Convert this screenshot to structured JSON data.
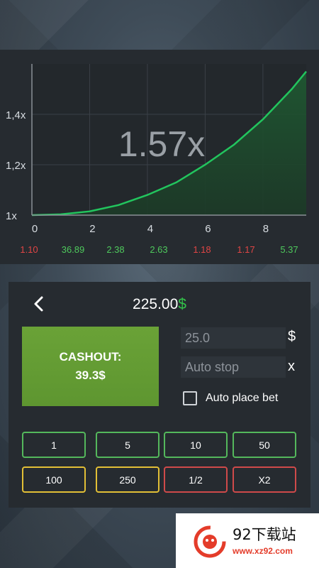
{
  "chart": {
    "multiplier": "1.57x",
    "y_ticks": [
      "1x",
      "1,2x",
      "1,4x"
    ],
    "x_ticks": [
      "0",
      "2",
      "4",
      "6",
      "8"
    ],
    "line_color": "#22c55e"
  },
  "chart_data": {
    "type": "area",
    "title": "",
    "xlabel": "",
    "ylabel": "",
    "xlim": [
      0,
      9.5
    ],
    "ylim": [
      1,
      1.6
    ],
    "x": [
      0,
      1,
      2,
      3,
      4,
      5,
      6,
      7,
      8,
      9,
      9.5
    ],
    "y": [
      1.0,
      1.003,
      1.015,
      1.04,
      1.08,
      1.13,
      1.2,
      1.28,
      1.38,
      1.5,
      1.57
    ],
    "grid": true
  },
  "history": [
    {
      "value": "1.10",
      "color": "red"
    },
    {
      "value": "36.89",
      "color": "green"
    },
    {
      "value": "2.38",
      "color": "green"
    },
    {
      "value": "2.63",
      "color": "green"
    },
    {
      "value": "1.18",
      "color": "red"
    },
    {
      "value": "1.17",
      "color": "red"
    },
    {
      "value": "5.37",
      "color": "green"
    }
  ],
  "bet_panel": {
    "balance_amount": "225.00",
    "balance_currency": "$",
    "cashout_label": "CASHOUT:",
    "cashout_amount": "39.3$",
    "bet_value": "25.0",
    "bet_suffix": "$",
    "auto_stop_placeholder": "Auto stop",
    "auto_stop_suffix": "x",
    "auto_place_label": "Auto place bet",
    "auto_place_checked": false,
    "chips_row1": [
      "1",
      "5",
      "10",
      "50"
    ],
    "chips_row2": [
      "100",
      "250",
      "1/2",
      "X2"
    ]
  },
  "watermark": {
    "title": "92下载站",
    "url": "www.xz92.com"
  }
}
